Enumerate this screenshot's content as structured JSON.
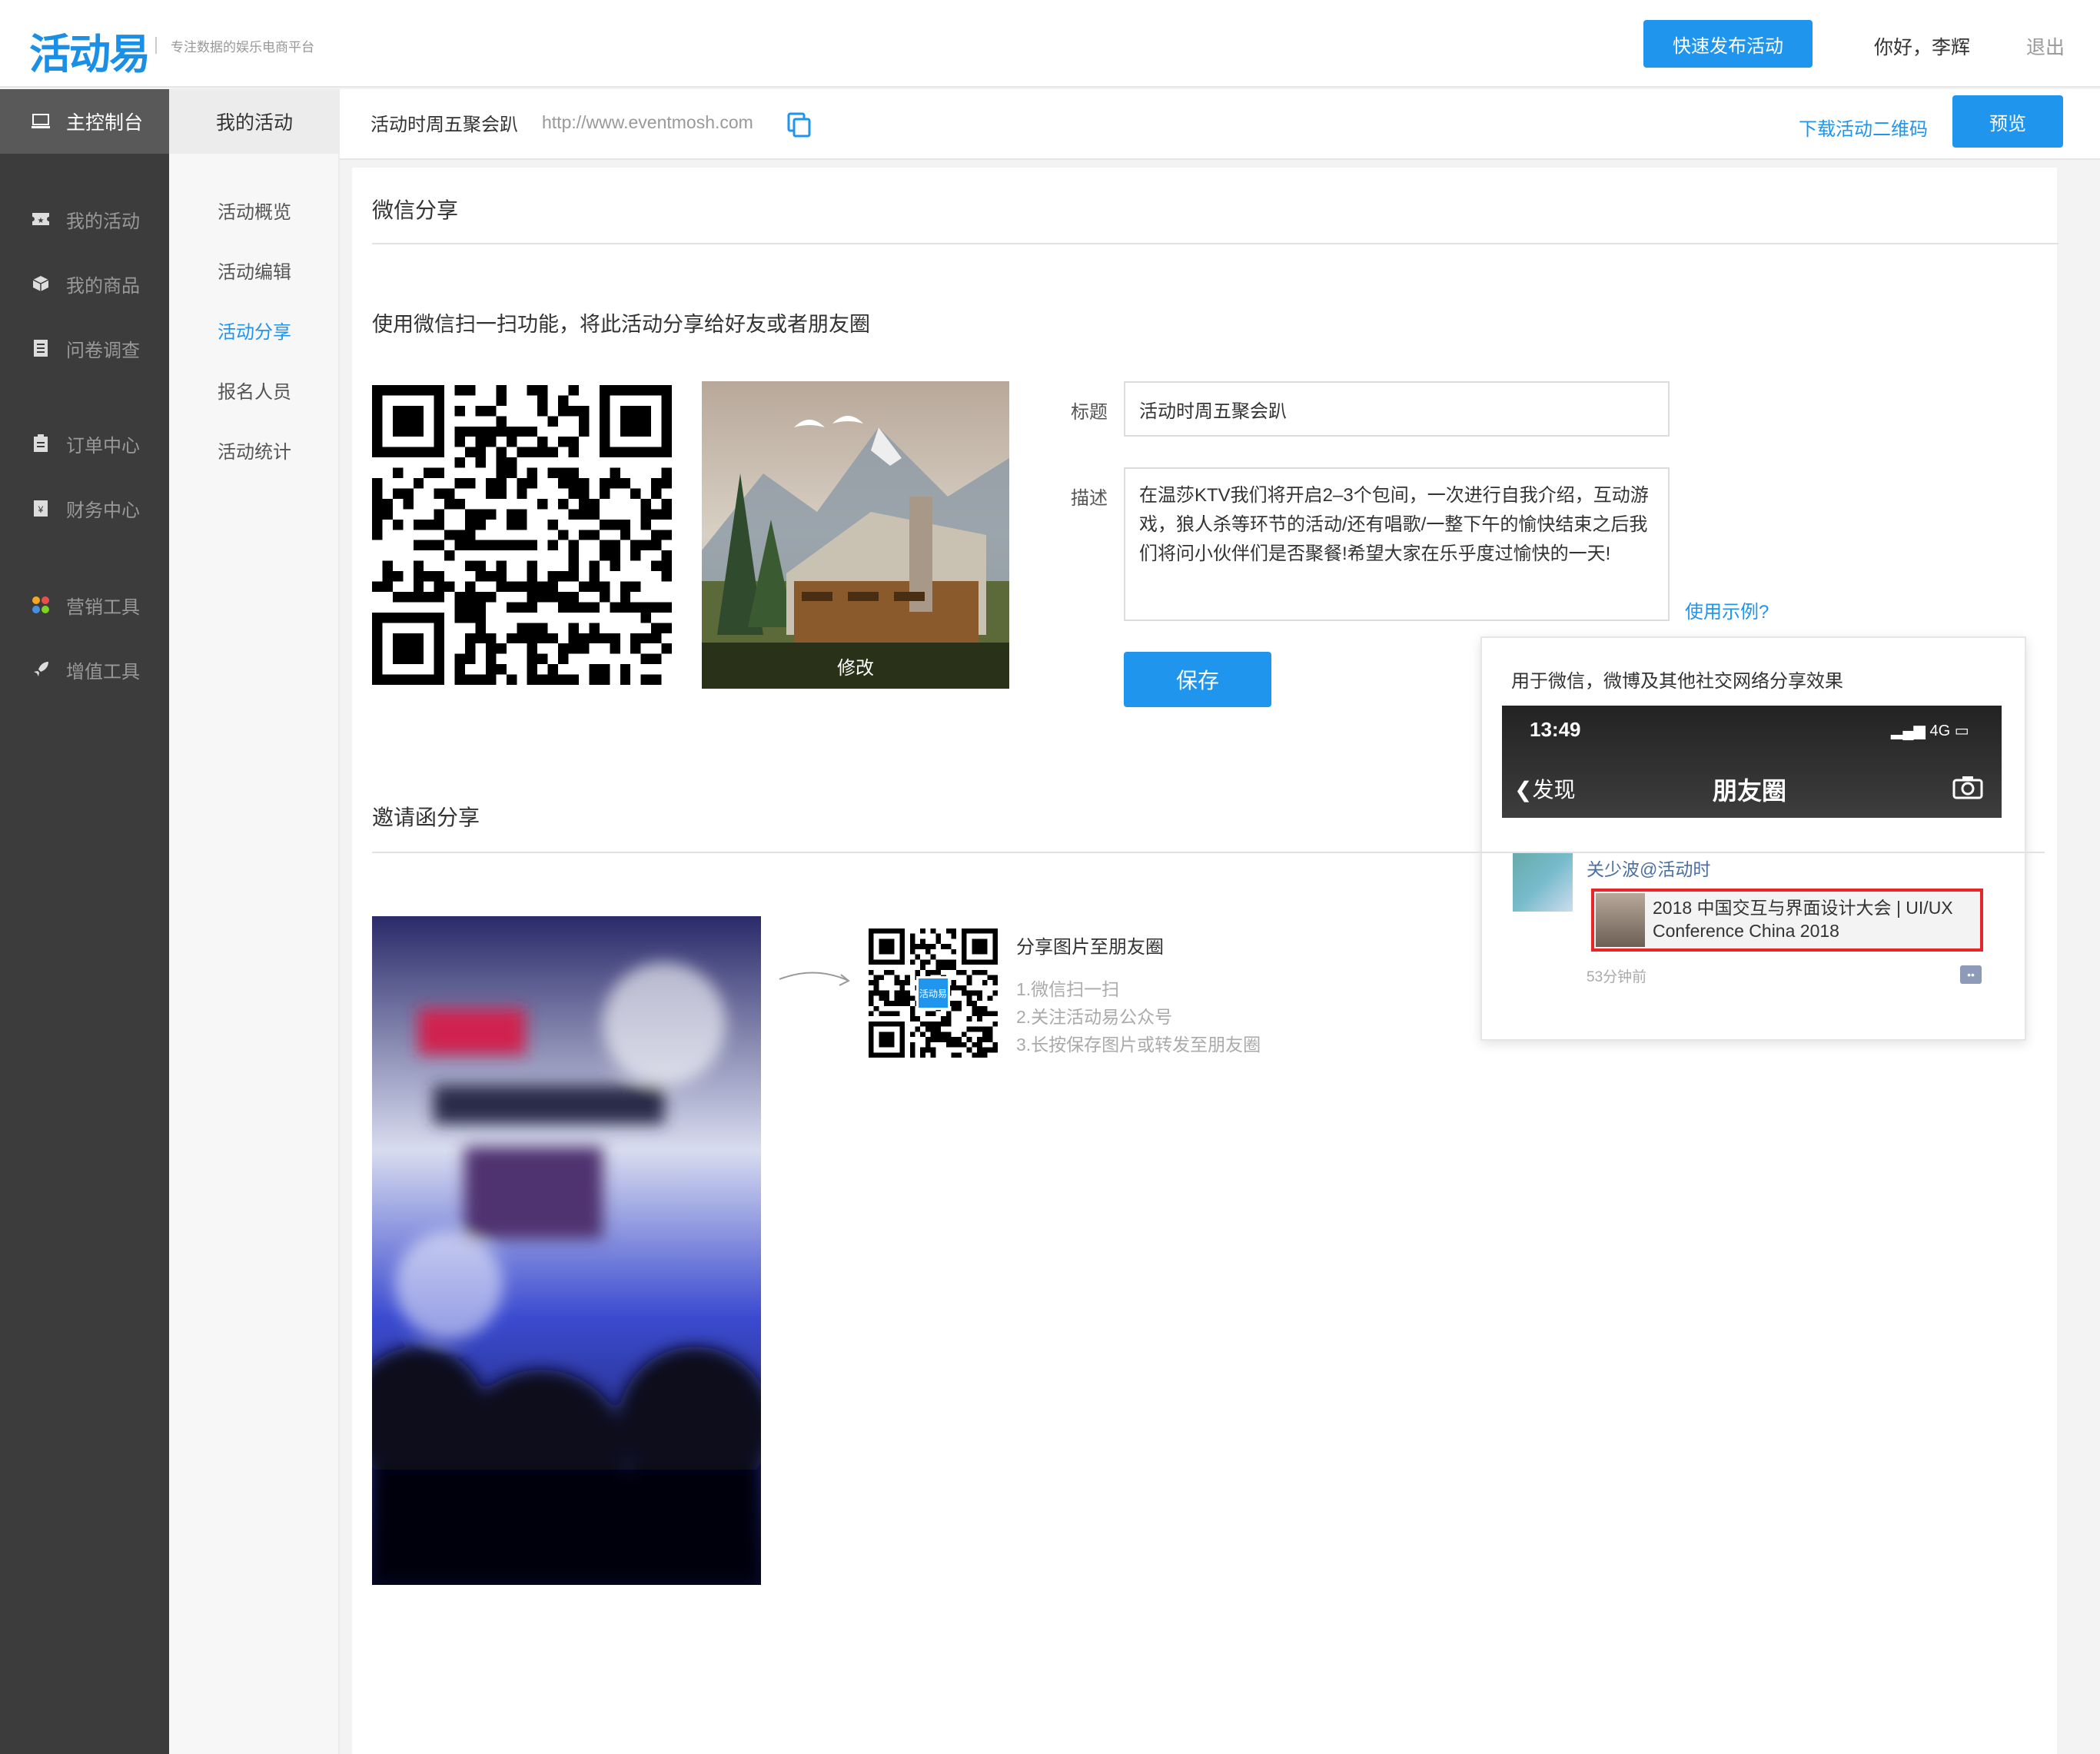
{
  "header": {
    "logo": "活动易",
    "tagline": "专注数据的娱乐电商平台",
    "publish_button": "快速发布活动",
    "greeting": "你好，李辉",
    "logout": "退出"
  },
  "sidebar": {
    "main": "主控制台",
    "items": [
      {
        "label": "我的活动",
        "icon": "ticket-icon"
      },
      {
        "label": "我的商品",
        "icon": "box-icon"
      },
      {
        "label": "问卷调查",
        "icon": "survey-icon"
      },
      {
        "label": "订单中心",
        "icon": "clipboard-icon"
      },
      {
        "label": "财务中心",
        "icon": "wallet-icon"
      },
      {
        "label": "营销工具",
        "icon": "apps-icon"
      },
      {
        "label": "增值工具",
        "icon": "rocket-icon"
      }
    ]
  },
  "subnav": {
    "title": "我的活动",
    "items": [
      {
        "label": "活动概览"
      },
      {
        "label": "活动编辑"
      },
      {
        "label": "活动分享",
        "active": true
      },
      {
        "label": "报名人员"
      },
      {
        "label": "活动统计"
      }
    ]
  },
  "topbar": {
    "event_name": "活动时周五聚会趴",
    "event_url": "http://www.eventmosh.com",
    "download_qr": "下载活动二维码",
    "preview": "预览"
  },
  "wechat": {
    "section_title": "微信分享",
    "description": "使用微信扫一扫功能，将此活动分享给好友或者朋友圈",
    "cover_edit": "修改",
    "title_label": "标题",
    "title_value": "活动时周五聚会趴",
    "desc_label": "描述",
    "desc_value": "在温莎KTV我们将开启2–3个包间，一次进行自我介绍，互动游戏，狼人杀等环节的活动/还有唱歌/一整下午的愉快结束之后我们将问小伙伴们是否聚餐!希望大家在乐乎度过愉快的一天!",
    "example_link": "使用示例?",
    "save": "保存"
  },
  "popup": {
    "title": "用于微信，微博及其他社交网络分享效果",
    "phone_time": "13:49",
    "phone_signal": "4G",
    "phone_back": "发现",
    "phone_title": "朋友圈",
    "user": "关少波@活动时",
    "card_text": "2018 中国交互与界面设计大会 | UI/UX Conference China 2018",
    "time_ago": "53分钟前"
  },
  "invite": {
    "section_title": "邀请函分享",
    "qr_label": "活动易",
    "heading": "分享图片至朋友圈",
    "steps": [
      "1.微信扫一扫",
      "2.关注活动易公众号",
      "3.长按保存图片或转发至朋友圈"
    ]
  },
  "colors": {
    "accent": "#1f95ee",
    "sidebar_bg": "#3c3c3c",
    "highlight_border": "#e8262a"
  }
}
